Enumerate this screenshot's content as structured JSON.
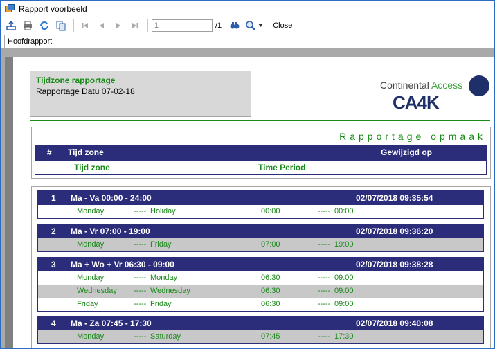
{
  "window": {
    "title": "Rapport voorbeeld"
  },
  "toolbar": {
    "page_value": "1",
    "page_total": "/1",
    "close_label": "Close"
  },
  "tabs": [
    {
      "label": "Hoofdrapport"
    }
  ],
  "report": {
    "header_title": "Tijdzone rapportage",
    "header_subtitle": "Rapportage Datu 07-02-18",
    "logo": {
      "line1_a": "Continental ",
      "line1_b": "Access",
      "line2": "CA4K"
    },
    "section_title": "Rapportage  opmaak",
    "columns": {
      "num": "#",
      "zone": "Tijd zone",
      "modified": "Gewijzigd op",
      "sub_zone": "Tijd zone",
      "sub_period": "Time Period"
    },
    "dash": "-----",
    "groups": [
      {
        "num": "1",
        "name": "Ma - Va 00:00 - 24:00",
        "modified": "02/07/2018 09:35:54",
        "rows": [
          {
            "from_day": "Monday",
            "to_day": "Holiday",
            "start": "00:00",
            "end": "00:00"
          }
        ]
      },
      {
        "num": "2",
        "name": "Ma - Vr 07:00 - 19:00",
        "modified": "02/07/2018 09:36:20",
        "rows": [
          {
            "from_day": "Monday",
            "to_day": "Friday",
            "start": "07:00",
            "end": "19:00"
          }
        ]
      },
      {
        "num": "3",
        "name": "Ma + Wo + Vr 06:30 - 09:00",
        "modified": "02/07/2018 09:38:28",
        "rows": [
          {
            "from_day": "Monday",
            "to_day": "Monday",
            "start": "06:30",
            "end": "09:00"
          },
          {
            "from_day": "Wednesday",
            "to_day": "Wednesday",
            "start": "06:30",
            "end": "09:00"
          },
          {
            "from_day": "Friday",
            "to_day": "Friday",
            "start": "06:30",
            "end": "09:00"
          }
        ]
      },
      {
        "num": "4",
        "name": "Ma - Za 07:45 - 17:30",
        "modified": "02/07/2018 09:40:08",
        "rows": [
          {
            "from_day": "Monday",
            "to_day": "Saturday",
            "start": "07:45",
            "end": "17:30"
          }
        ]
      }
    ]
  },
  "colors": {
    "accent_green": "#1a8a1a",
    "header_navy": "#2b2c7a",
    "row_alt": "#c8c8c8"
  },
  "icons": [
    "export-icon",
    "print-icon",
    "refresh-icon",
    "copy-icon",
    "first-page-icon",
    "prev-page-icon",
    "next-page-icon",
    "last-page-icon",
    "find-icon",
    "zoom-icon"
  ]
}
